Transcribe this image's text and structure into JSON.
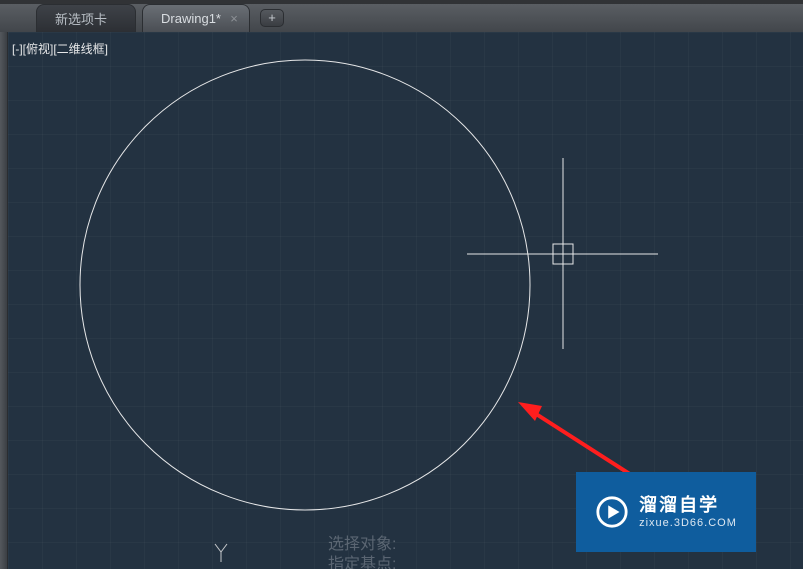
{
  "tabs": {
    "items": [
      {
        "label": "新选项卡",
        "active": false
      },
      {
        "label": "Drawing1*",
        "active": true
      }
    ],
    "add_label": "+"
  },
  "viewport": {
    "label": "[-][俯视][二维线框]"
  },
  "cmdline": {
    "line1": "选择对象:",
    "line2": "指定基点:"
  },
  "watermark": {
    "brand": "溜溜自学",
    "url": "zixue.3D66.COM"
  }
}
